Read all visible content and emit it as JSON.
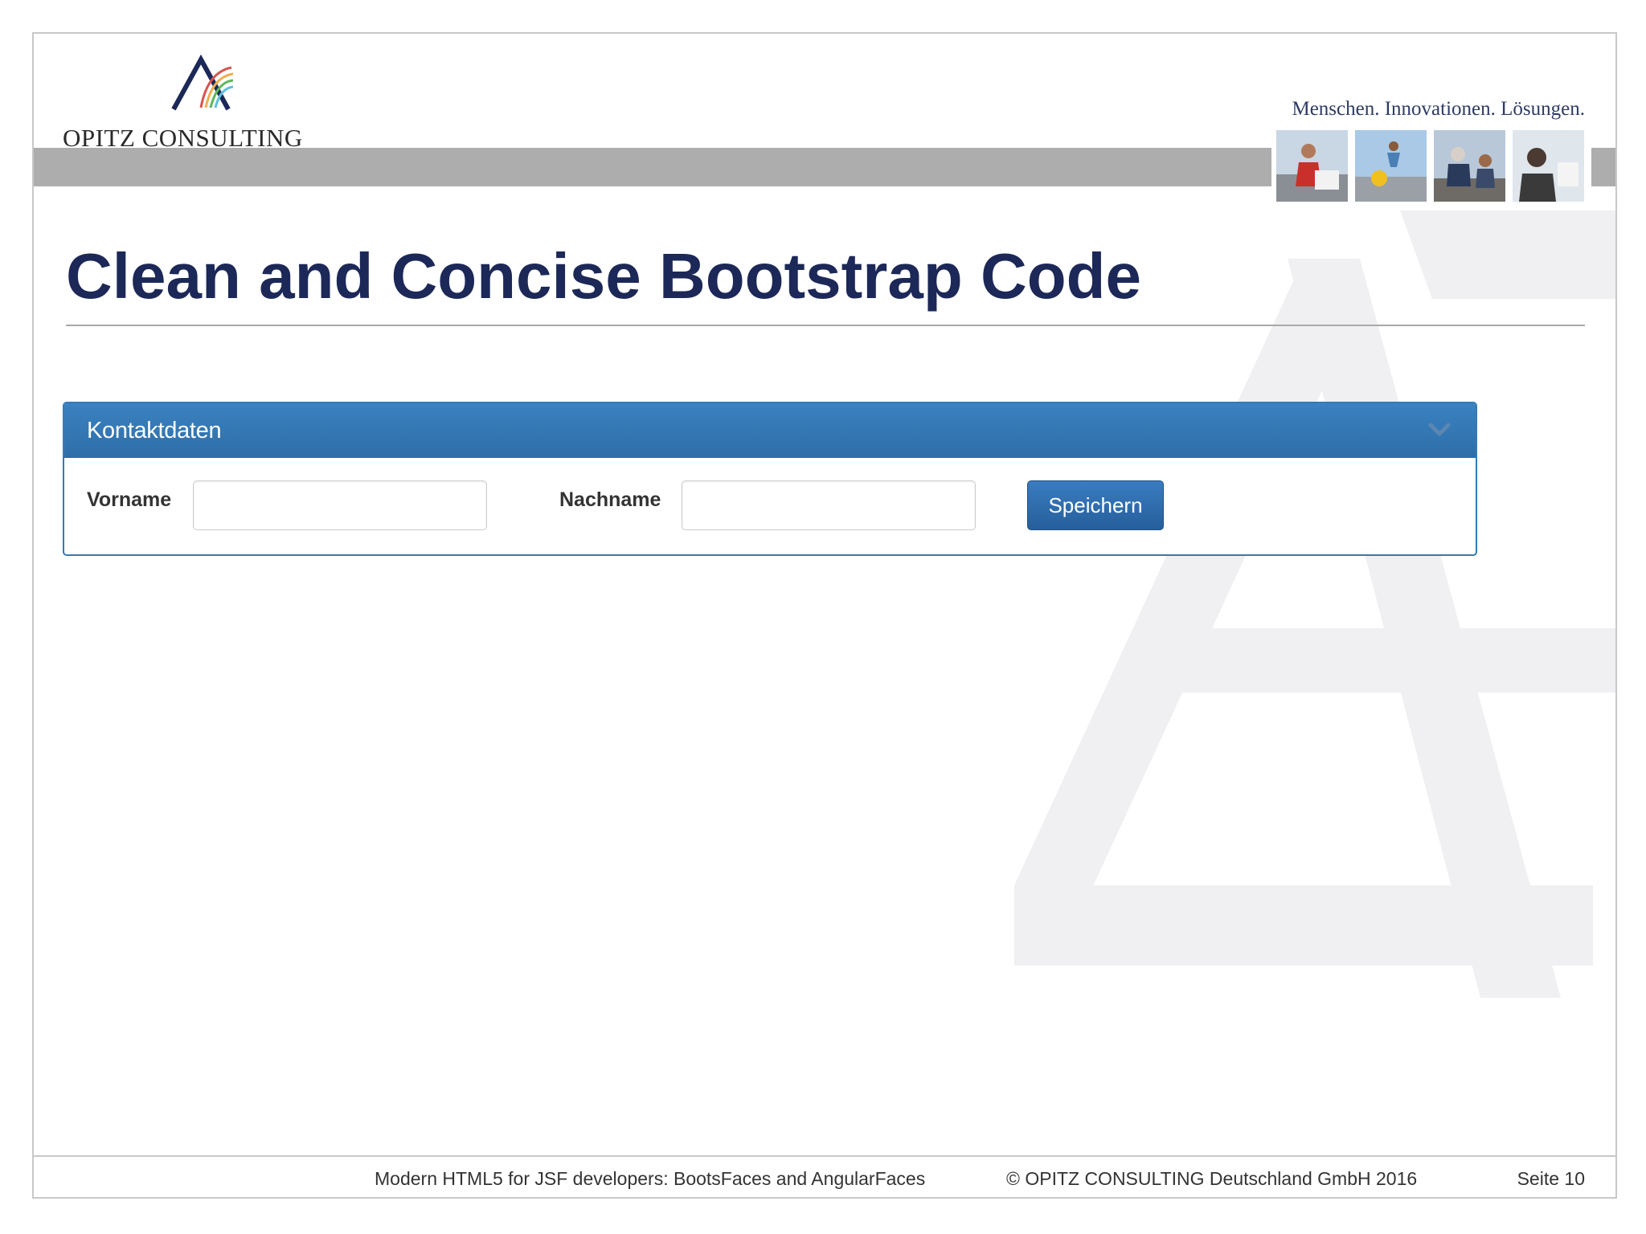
{
  "header": {
    "logo_text": "OPITZ CONSULTING",
    "tagline": "Menschen. Innovationen. Lösungen."
  },
  "slide": {
    "title": "Clean and Concise Bootstrap Code"
  },
  "panel": {
    "title": "Kontaktdaten",
    "fields": [
      {
        "label": "Vorname",
        "value": ""
      },
      {
        "label": "Nachname",
        "value": ""
      }
    ],
    "save_label": "Speichern"
  },
  "footer": {
    "presentation": "Modern HTML5 for JSF developers: BootsFaces and AngularFaces",
    "copyright": "© OPITZ CONSULTING Deutschland GmbH 2016",
    "page": "Seite 10"
  },
  "colors": {
    "title": "#1c2857",
    "panel_primary": "#337ab7",
    "header_bar": "#adadad"
  },
  "icons": {
    "panel_toggle": "chevron-down-icon"
  }
}
